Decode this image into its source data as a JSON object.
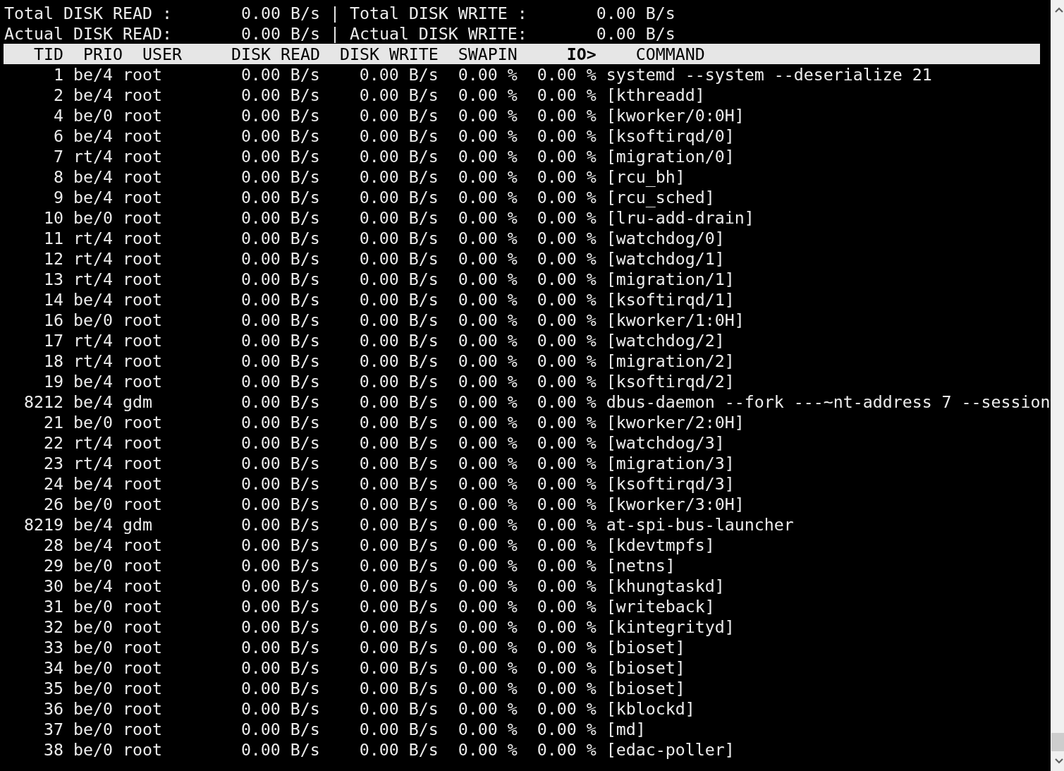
{
  "summary": [
    {
      "read_label": "Total DISK READ :",
      "read_value": "0.00 B/s",
      "separator": "|",
      "write_label": "Total DISK WRITE :",
      "write_value": "0.00 B/s"
    },
    {
      "read_label": "Actual DISK READ:",
      "read_value": "0.00 B/s",
      "separator": "|",
      "write_label": "Actual DISK WRITE:",
      "write_value": "0.00 B/s"
    }
  ],
  "columns": [
    {
      "label": "TID",
      "sorted": false
    },
    {
      "label": "PRIO",
      "sorted": false
    },
    {
      "label": "USER",
      "sorted": false
    },
    {
      "label": "DISK READ",
      "sorted": false
    },
    {
      "label": "DISK WRITE",
      "sorted": false
    },
    {
      "label": "SWAPIN",
      "sorted": false
    },
    {
      "label": "IO>",
      "sorted": true
    },
    {
      "label": "COMMAND",
      "sorted": false
    }
  ],
  "rows": [
    [
      "1",
      "be/4",
      "root",
      "0.00 B/s",
      "0.00 B/s",
      "0.00 %",
      "0.00 %",
      "systemd --system --deserialize 21"
    ],
    [
      "2",
      "be/4",
      "root",
      "0.00 B/s",
      "0.00 B/s",
      "0.00 %",
      "0.00 %",
      "[kthreadd]"
    ],
    [
      "4",
      "be/0",
      "root",
      "0.00 B/s",
      "0.00 B/s",
      "0.00 %",
      "0.00 %",
      "[kworker/0:0H]"
    ],
    [
      "6",
      "be/4",
      "root",
      "0.00 B/s",
      "0.00 B/s",
      "0.00 %",
      "0.00 %",
      "[ksoftirqd/0]"
    ],
    [
      "7",
      "rt/4",
      "root",
      "0.00 B/s",
      "0.00 B/s",
      "0.00 %",
      "0.00 %",
      "[migration/0]"
    ],
    [
      "8",
      "be/4",
      "root",
      "0.00 B/s",
      "0.00 B/s",
      "0.00 %",
      "0.00 %",
      "[rcu_bh]"
    ],
    [
      "9",
      "be/4",
      "root",
      "0.00 B/s",
      "0.00 B/s",
      "0.00 %",
      "0.00 %",
      "[rcu_sched]"
    ],
    [
      "10",
      "be/0",
      "root",
      "0.00 B/s",
      "0.00 B/s",
      "0.00 %",
      "0.00 %",
      "[lru-add-drain]"
    ],
    [
      "11",
      "rt/4",
      "root",
      "0.00 B/s",
      "0.00 B/s",
      "0.00 %",
      "0.00 %",
      "[watchdog/0]"
    ],
    [
      "12",
      "rt/4",
      "root",
      "0.00 B/s",
      "0.00 B/s",
      "0.00 %",
      "0.00 %",
      "[watchdog/1]"
    ],
    [
      "13",
      "rt/4",
      "root",
      "0.00 B/s",
      "0.00 B/s",
      "0.00 %",
      "0.00 %",
      "[migration/1]"
    ],
    [
      "14",
      "be/4",
      "root",
      "0.00 B/s",
      "0.00 B/s",
      "0.00 %",
      "0.00 %",
      "[ksoftirqd/1]"
    ],
    [
      "16",
      "be/0",
      "root",
      "0.00 B/s",
      "0.00 B/s",
      "0.00 %",
      "0.00 %",
      "[kworker/1:0H]"
    ],
    [
      "17",
      "rt/4",
      "root",
      "0.00 B/s",
      "0.00 B/s",
      "0.00 %",
      "0.00 %",
      "[watchdog/2]"
    ],
    [
      "18",
      "rt/4",
      "root",
      "0.00 B/s",
      "0.00 B/s",
      "0.00 %",
      "0.00 %",
      "[migration/2]"
    ],
    [
      "19",
      "be/4",
      "root",
      "0.00 B/s",
      "0.00 B/s",
      "0.00 %",
      "0.00 %",
      "[ksoftirqd/2]"
    ],
    [
      "8212",
      "be/4",
      "gdm",
      "0.00 B/s",
      "0.00 B/s",
      "0.00 %",
      "0.00 %",
      "dbus-daemon --fork ---~nt-address 7 --session"
    ],
    [
      "21",
      "be/0",
      "root",
      "0.00 B/s",
      "0.00 B/s",
      "0.00 %",
      "0.00 %",
      "[kworker/2:0H]"
    ],
    [
      "22",
      "rt/4",
      "root",
      "0.00 B/s",
      "0.00 B/s",
      "0.00 %",
      "0.00 %",
      "[watchdog/3]"
    ],
    [
      "23",
      "rt/4",
      "root",
      "0.00 B/s",
      "0.00 B/s",
      "0.00 %",
      "0.00 %",
      "[migration/3]"
    ],
    [
      "24",
      "be/4",
      "root",
      "0.00 B/s",
      "0.00 B/s",
      "0.00 %",
      "0.00 %",
      "[ksoftirqd/3]"
    ],
    [
      "26",
      "be/0",
      "root",
      "0.00 B/s",
      "0.00 B/s",
      "0.00 %",
      "0.00 %",
      "[kworker/3:0H]"
    ],
    [
      "8219",
      "be/4",
      "gdm",
      "0.00 B/s",
      "0.00 B/s",
      "0.00 %",
      "0.00 %",
      "at-spi-bus-launcher"
    ],
    [
      "28",
      "be/4",
      "root",
      "0.00 B/s",
      "0.00 B/s",
      "0.00 %",
      "0.00 %",
      "[kdevtmpfs]"
    ],
    [
      "29",
      "be/0",
      "root",
      "0.00 B/s",
      "0.00 B/s",
      "0.00 %",
      "0.00 %",
      "[netns]"
    ],
    [
      "30",
      "be/4",
      "root",
      "0.00 B/s",
      "0.00 B/s",
      "0.00 %",
      "0.00 %",
      "[khungtaskd]"
    ],
    [
      "31",
      "be/0",
      "root",
      "0.00 B/s",
      "0.00 B/s",
      "0.00 %",
      "0.00 %",
      "[writeback]"
    ],
    [
      "32",
      "be/0",
      "root",
      "0.00 B/s",
      "0.00 B/s",
      "0.00 %",
      "0.00 %",
      "[kintegrityd]"
    ],
    [
      "33",
      "be/0",
      "root",
      "0.00 B/s",
      "0.00 B/s",
      "0.00 %",
      "0.00 %",
      "[bioset]"
    ],
    [
      "34",
      "be/0",
      "root",
      "0.00 B/s",
      "0.00 B/s",
      "0.00 %",
      "0.00 %",
      "[bioset]"
    ],
    [
      "35",
      "be/0",
      "root",
      "0.00 B/s",
      "0.00 B/s",
      "0.00 %",
      "0.00 %",
      "[bioset]"
    ],
    [
      "36",
      "be/0",
      "root",
      "0.00 B/s",
      "0.00 B/s",
      "0.00 %",
      "0.00 %",
      "[kblockd]"
    ],
    [
      "37",
      "be/0",
      "root",
      "0.00 B/s",
      "0.00 B/s",
      "0.00 %",
      "0.00 %",
      "[md]"
    ],
    [
      "38",
      "be/0",
      "root",
      "0.00 B/s",
      "0.00 B/s",
      "0.00 %",
      "0.00 %",
      "[edac-poller]"
    ]
  ]
}
